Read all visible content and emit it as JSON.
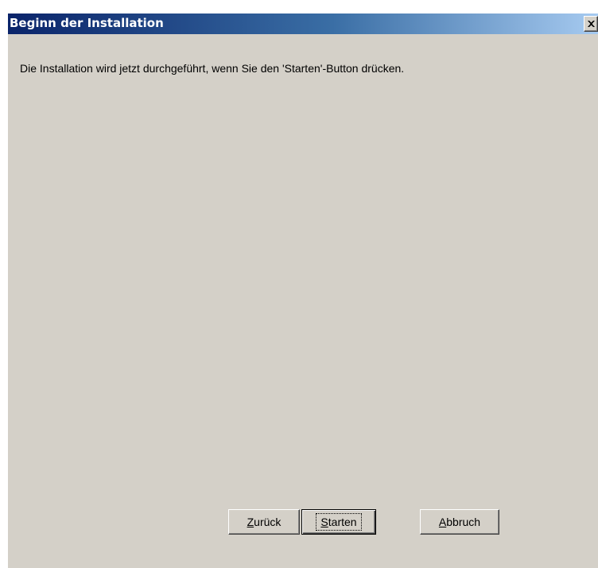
{
  "window": {
    "title": "Beginn der Installation",
    "close_glyph": "close-icon"
  },
  "content": {
    "message": "Die Installation wird jetzt durchgeführt, wenn Sie den 'Starten'-Button drücken."
  },
  "buttons": {
    "back": {
      "mnemonic": "Z",
      "rest": "urück"
    },
    "start": {
      "mnemonic": "S",
      "rest": "tarten"
    },
    "cancel": {
      "mnemonic": "A",
      "rest": "bbruch"
    }
  },
  "colors": {
    "title_gradient_start": "#0a246a",
    "title_gradient_end": "#a6caf0",
    "face": "#d4d0c8"
  }
}
